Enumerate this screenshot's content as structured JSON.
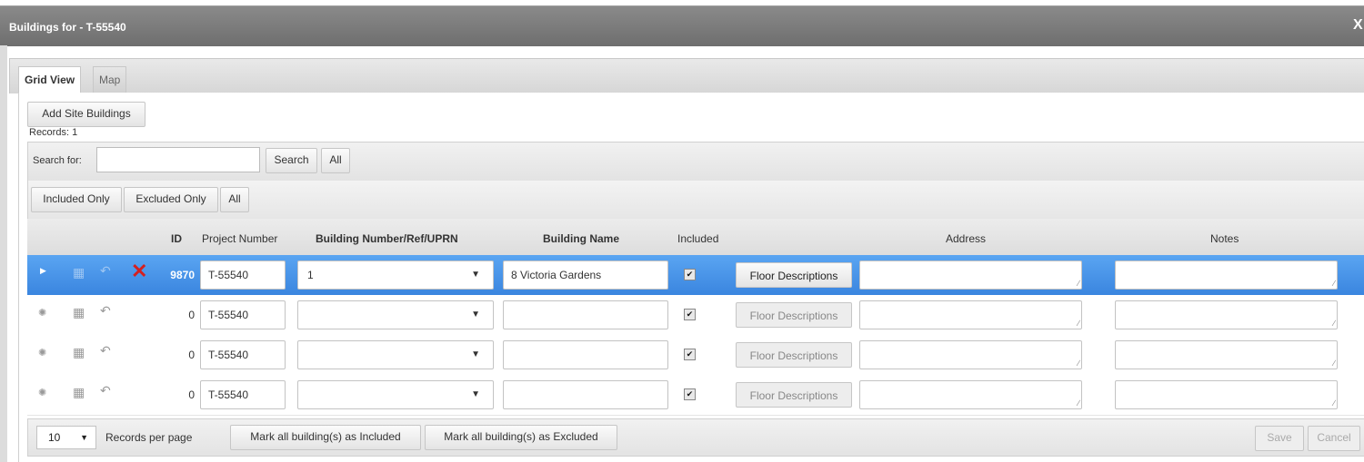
{
  "window": {
    "title": "Buildings for - T-55540",
    "close_glyph": "X"
  },
  "tabs": [
    {
      "label": "Grid View",
      "active": true
    },
    {
      "label": "Map",
      "active": false
    }
  ],
  "toolbar": {
    "add_site_buildings": "Add Site Buildings",
    "records_label": "Records: 1"
  },
  "search": {
    "label": "Search for:",
    "value": "",
    "search_button": "Search",
    "all_button": "All"
  },
  "filters": {
    "included_only": "Included Only",
    "excluded_only": "Excluded Only",
    "all": "All"
  },
  "columns": {
    "id": "ID",
    "project_number": "Project Number",
    "building_number": "Building Number/Ref/UPRN",
    "building_name": "Building Name",
    "included": "Included",
    "address": "Address",
    "notes": "Notes"
  },
  "rows": [
    {
      "id": "9870",
      "project_number": "T-55540",
      "building_number": "1",
      "building_name": "8 Victoria Gardens",
      "included": true,
      "floor_button": "Floor Descriptions",
      "address": "",
      "notes": "",
      "selected": true
    },
    {
      "id": "0",
      "project_number": "T-55540",
      "building_number": "",
      "building_name": "",
      "included": true,
      "floor_button": "Floor Descriptions",
      "address": "",
      "notes": "",
      "selected": false
    },
    {
      "id": "0",
      "project_number": "T-55540",
      "building_number": "",
      "building_name": "",
      "included": true,
      "floor_button": "Floor Descriptions",
      "address": "",
      "notes": "",
      "selected": false
    },
    {
      "id": "0",
      "project_number": "T-55540",
      "building_number": "",
      "building_name": "",
      "included": true,
      "floor_button": "Floor Descriptions",
      "address": "",
      "notes": "",
      "selected": false
    }
  ],
  "footer": {
    "page_size": "10",
    "records_per_page": "Records per page",
    "mark_included": "Mark all building(s) as Included",
    "mark_excluded": "Mark all building(s) as Excluded",
    "save": "Save",
    "cancel": "Cancel"
  },
  "icons": {
    "expand": "triangle-right",
    "save": "floppy-disk",
    "undo": "undo-arrow",
    "delete": "red-x",
    "new": "asterisk"
  },
  "colors": {
    "selected_row": "#3a85df",
    "delete_red": "#d42020",
    "titlebar": "#777777"
  }
}
